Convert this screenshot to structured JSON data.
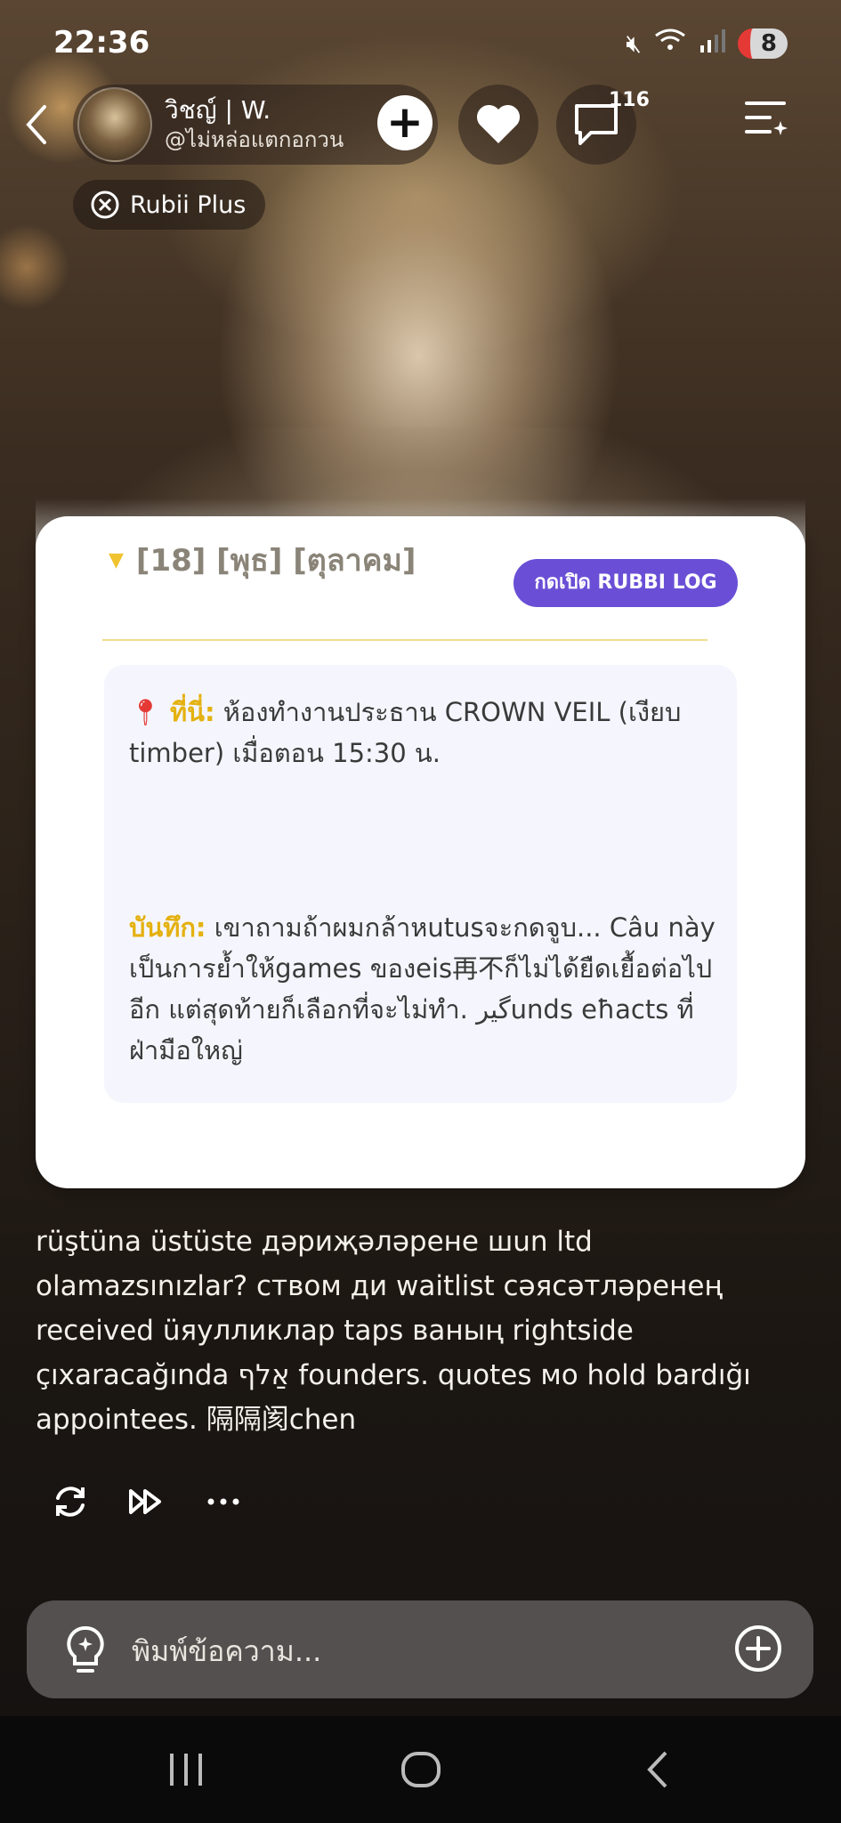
{
  "status_bar": {
    "time": "22:36",
    "battery": "8"
  },
  "header": {
    "name": "วิชญ์ | W.",
    "handle": "@ไม่หล่อแตกอกวน",
    "comment_count": "116",
    "rubii_plus": "Rubii Plus"
  },
  "card": {
    "date": "[18] [พุธ] [ตุลาคม]",
    "log_button": "กดเปิด RUBBI LOG",
    "location_label": "ที่นี่:",
    "location_text": " ห้องทำงานประธาน CROWN VEIL (เงียบ timber) เมื่อตอน 15:30 น.",
    "note_label": "บันทึก:",
    "note_text": " เขาถามถ้าผมกล้าหutusจะกดจูบ... Câu này เป็นการย้ำให้games ของeis再不ก็ไม่ได้ยืดเยื้อต่อไปอีก แต่สุดท้ายก็เลือกที่จะไม่ทำ. گیرunds eħacts ที่ฝ่ามือใหญ่"
  },
  "message": "rüştüna üstüste дəриҗәләрене шun ltd olamazsınızlar? ством ди waitlist сәясәтләренең received üяулликлар taps ваның rightside çıxaracağında אַלף founders. quotes мо hold bardığı appointees. 隔隔阂chen",
  "input": {
    "placeholder": "พิมพ์ข้อความ..."
  },
  "icons": {
    "back": "back-arrow-icon",
    "add": "plus-icon",
    "like": "heart-icon",
    "comment": "comment-bubble-icon",
    "menu": "playlist-menu-icon",
    "regenerate": "refresh-icon",
    "continue": "fast-forward-icon",
    "more": "more-icon",
    "hint": "lightbulb-icon",
    "attach": "add-circle-icon"
  }
}
